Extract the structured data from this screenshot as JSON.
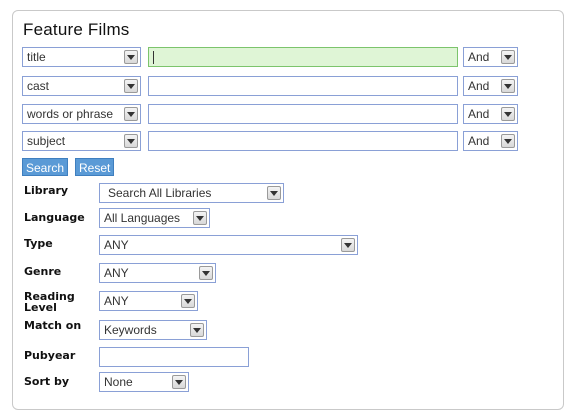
{
  "form": {
    "title": "Feature Films",
    "rows": [
      {
        "field": "title",
        "value": "",
        "op": "And"
      },
      {
        "field": "cast",
        "value": "",
        "op": "And"
      },
      {
        "field": "words or phrase",
        "value": "",
        "op": "And"
      },
      {
        "field": "subject",
        "value": "",
        "op": "And"
      }
    ],
    "search_label": "Search",
    "reset_label": "Reset"
  },
  "filters": {
    "library": {
      "label": "Library",
      "value": "Search All Libraries"
    },
    "language": {
      "label": "Language",
      "value": "All Languages"
    },
    "type": {
      "label": "Type",
      "value": "ANY"
    },
    "genre": {
      "label": "Genre",
      "value": "ANY"
    },
    "reading_level": {
      "label": "Reading Level",
      "value": "ANY"
    },
    "match_on": {
      "label": "Match on",
      "value": "Keywords"
    },
    "pubyear": {
      "label": "Pubyear",
      "value": ""
    },
    "sort_by": {
      "label": "Sort by",
      "value": "None"
    }
  },
  "icons": {
    "dropdown": "chevron-down-icon"
  },
  "colors": {
    "accent": "#5a9ad6",
    "focus_field": "#dff5d6",
    "border": "#8aa0d6"
  }
}
